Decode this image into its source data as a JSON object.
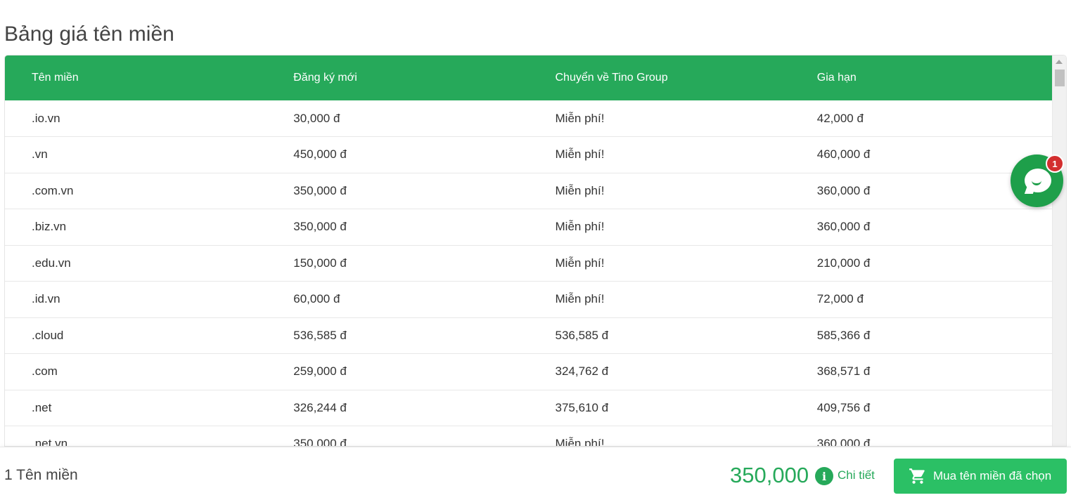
{
  "page": {
    "title": "Bảng giá tên miền"
  },
  "table": {
    "headers": [
      "Tên miền",
      "Đăng ký mới",
      "Chuyển về Tino Group",
      "Gia hạn"
    ],
    "rows": [
      [
        ".io.vn",
        "30,000 đ",
        "Miễn phí!",
        "42,000 đ"
      ],
      [
        ".vn",
        "450,000 đ",
        "Miễn phí!",
        "460,000 đ"
      ],
      [
        ".com.vn",
        "350,000 đ",
        "Miễn phí!",
        "360,000 đ"
      ],
      [
        ".biz.vn",
        "350,000 đ",
        "Miễn phí!",
        "360,000 đ"
      ],
      [
        ".edu.vn",
        "150,000 đ",
        "Miễn phí!",
        "210,000 đ"
      ],
      [
        ".id.vn",
        "60,000 đ",
        "Miễn phí!",
        "72,000 đ"
      ],
      [
        ".cloud",
        "536,585 đ",
        "536,585 đ",
        "585,366 đ"
      ],
      [
        ".com",
        "259,000 đ",
        "324,762 đ",
        "368,571 đ"
      ],
      [
        ".net",
        "326,244 đ",
        "375,610 đ",
        "409,756 đ"
      ],
      [
        ".net.vn",
        "350,000 đ",
        "Miễn phí!",
        "360,000 đ"
      ]
    ]
  },
  "chat": {
    "badge_count": "1",
    "icon": "chat-bubble-icon"
  },
  "footer": {
    "selected_count": "1 Tên miền",
    "total": "350,000",
    "detail_label": "Chi tiết",
    "buy_label": "Mua tên miền đã chọn"
  },
  "colors": {
    "accent_green": "#26a95a",
    "button_green": "#2bc065",
    "badge_red": "#d32f2f"
  }
}
